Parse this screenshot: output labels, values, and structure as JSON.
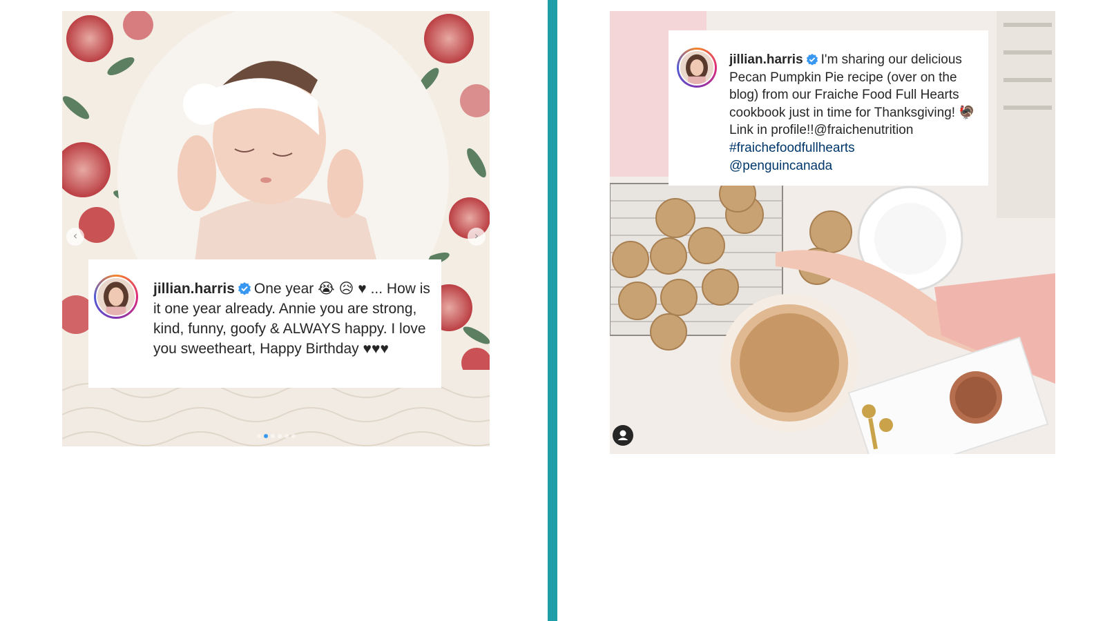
{
  "colors": {
    "divider": "#1e9ea6",
    "verified_badge": "#3897f0",
    "hashtag_link": "#00376b",
    "caption_text": "#262626",
    "avatar_ring": [
      "#f58529",
      "#dd2a7b",
      "#8134af",
      "#515bd4"
    ]
  },
  "left_post": {
    "photo_description_icon": "baby-photo",
    "nav": {
      "prev_glyph": "‹",
      "next_glyph": "›"
    },
    "carousel": {
      "total_slides": 6,
      "active_slide": 2
    },
    "caption": {
      "username": "jillian.harris",
      "verified_icon": "verified-badge-icon",
      "text_part1": "One year",
      "emoji_1": "😭",
      "emoji_2": "😥",
      "heart": "♥",
      "text_part2": "... How is it one year already. Annie you are strong, kind, funny, goofy & ALWAYS happy. I love you sweetheart, Happy Birthday",
      "trailing_hearts": "♥♥♥"
    }
  },
  "right_post": {
    "photo_description_icon": "baking-photo",
    "user_tag_icon": "person-icon",
    "caption": {
      "username": "jillian.harris",
      "verified_icon": "verified-badge-icon",
      "text_part1": "I'm sharing our delicious Pecan Pumpkin Pie recipe (over on the blog) from our Fraiche Food Full Hearts cookbook just in time for Thanksgiving!",
      "emoji_1": "🦃",
      "text_part2": "Link in profile!!@fraichenutrition",
      "hashtag": "#fraichefoodfullhearts",
      "mention": "@penguincanada"
    }
  }
}
